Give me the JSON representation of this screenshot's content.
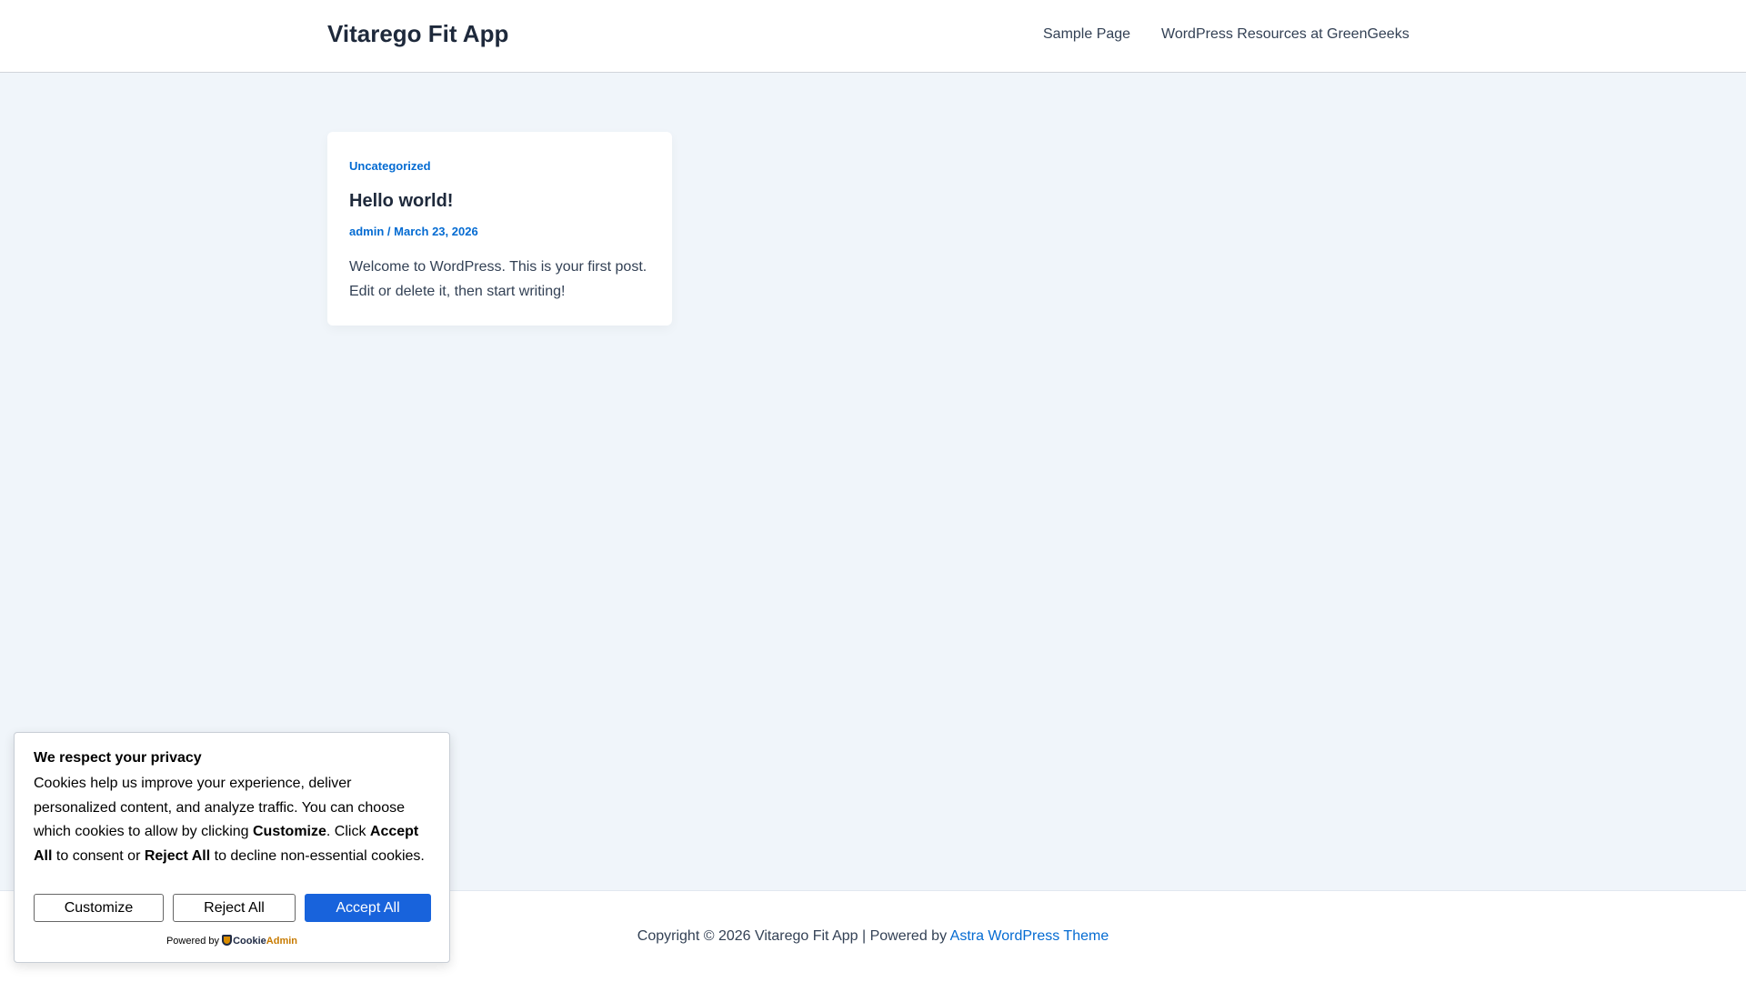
{
  "header": {
    "site_title": "Vitarego Fit App",
    "nav": [
      "Sample Page",
      "WordPress Resources at GreenGeeks"
    ]
  },
  "post": {
    "category": "Uncategorized",
    "title": "Hello world!",
    "author": "admin",
    "separator": "/",
    "date": "March 23, 2026",
    "excerpt": "Welcome to WordPress. This is your first post. Edit or delete it, then start writing!"
  },
  "footer": {
    "copyright": "Copyright © 2026 Vitarego Fit App | Powered by ",
    "theme_link": "Astra WordPress Theme"
  },
  "cookie": {
    "heading": "We respect your privacy",
    "body_1": "Cookies help us improve your experience, deliver personalized content, and analyze traffic. You can choose which cookies to allow by clicking ",
    "b1": "Customize",
    "body_2": ". Click ",
    "b2": "Accept All",
    "body_3": " to consent or ",
    "b3": "Reject All",
    "body_4": " to decline non-essential cookies.",
    "customize": "Customize",
    "reject": "Reject All",
    "accept": "Accept All",
    "powered_by": "Powered by",
    "brand_1": "Cookie",
    "brand_2": "Admin",
    "accent": "#1863dc"
  }
}
